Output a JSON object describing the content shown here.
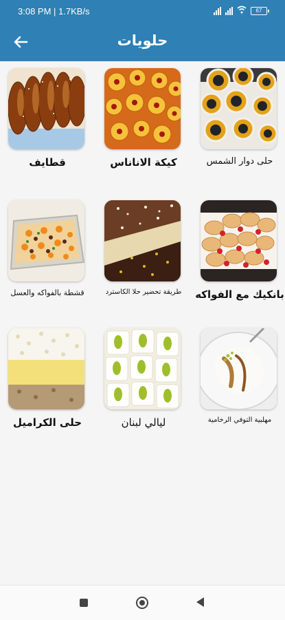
{
  "status_bar": {
    "time": "3:08 PM",
    "speed": "| 1.7KB/s",
    "battery": "67"
  },
  "app_bar": {
    "title": "حلويات",
    "back_icon": "arrow-left-icon"
  },
  "items": [
    {
      "label": "حلى دوار الشمس"
    },
    {
      "label": "كيكة الاناناس"
    },
    {
      "label": "قطايف"
    },
    {
      "label": "بانكيك مع الفواكه"
    },
    {
      "label": "طريقة تحضير حلا الكاسترد"
    },
    {
      "label": "قشطة بالفواكه والعسل"
    },
    {
      "label": "مهلبية التوفي الرخامية"
    },
    {
      "label": "ليالي لبنان"
    },
    {
      "label": "حلى الكراميل"
    }
  ],
  "nav_bar": {
    "recents": "square-icon",
    "home": "circle-icon",
    "back": "triangle-back-icon"
  },
  "colors": {
    "primary": "#2e80b5"
  }
}
